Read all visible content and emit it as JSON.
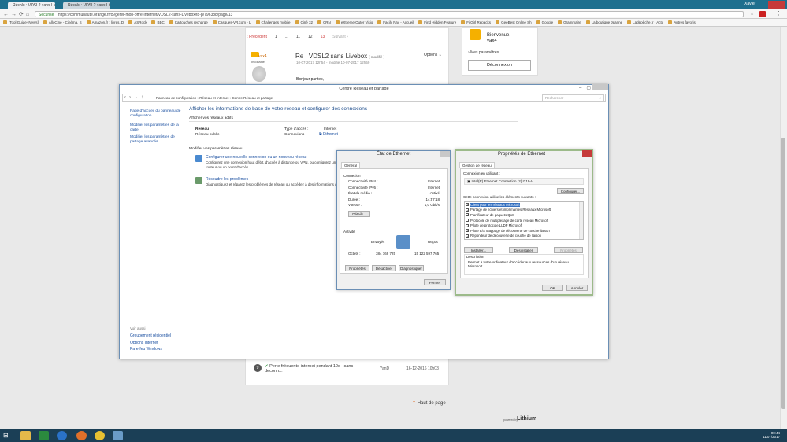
{
  "browser": {
    "tabs": [
      {
        "label": "Résolu : VDSL2 sans Liv"
      },
      {
        "label": "Résolu : VDSL2 sans Liv"
      }
    ],
    "user": "Xavier",
    "secure": "Sécurisé",
    "url": "https://communaute.orange.fr/t5/gérer-mon-offre-Internet/VDSL2-sans-Livebox/td-p/796388/page/13",
    "bookmarks": [
      "[Tool Guide+News]",
      "AlloCiné - Cinéma, S",
      "Amazon.fr : livres, D",
      "ASRock",
      "BBC",
      "Cartouches recharge",
      "Casques-VR.com - L",
      "Challenges mobile",
      "Ciné 32",
      "CRN",
      "eXtreme Outer Visio",
      "Facily Pay - Accueil",
      "Find Hidden Feature",
      "FitGirl Repacks",
      "GeeBest Online Sh",
      "Google",
      "Grammaire",
      "La boutique Jeanne",
      "Ladépêche.fr - Actu",
      "Autres favoris"
    ]
  },
  "forum": {
    "pagination": {
      "prev": "Précédent",
      "pages": [
        "1",
        "...",
        "11",
        "12",
        "13"
      ],
      "next": "Suivant"
    },
    "post": {
      "author": "vax4",
      "rank": "Incollable",
      "title": "Re : VDSL2 sans Livebox",
      "modified": "[ modifié ]",
      "date": "10-07-2017 12h54 - modifié 10-07-2017 12h59",
      "options": "Options",
      "body": "Bonjour pantec,"
    },
    "sidebar": {
      "welcome": "Bienvenue,",
      "user": "vax4",
      "settings": "Mes paramètres",
      "logout": "Déconnexion"
    },
    "related": {
      "title": "Perte fréquente internet pendant 10s - sans deconn...",
      "author": "YanD",
      "date": "16-12-2016 10h03",
      "count": "9"
    },
    "top": "Haut de page",
    "powered": "powered by",
    "brand": "Lithium"
  },
  "cp": {
    "title": "Centre Réseau et partage",
    "breadcrumb": [
      "Panneau de configuration",
      "Réseau et Internet",
      "Centre Réseau et partage"
    ],
    "search": "Rechercher",
    "side": [
      "Page d'accueil du panneau de configuration",
      "Modifier les paramètres de la carte",
      "Modifier les paramètres de partage avancés"
    ],
    "see_also_title": "Voir aussi",
    "see_also": [
      "Groupement résidentiel",
      "Options Internet",
      "Pare-feu Windows"
    ],
    "heading": "Afficher les informations de base de votre réseau et configurer des connexions",
    "active": "Afficher vos réseaux actifs",
    "net_name": "Réseau",
    "net_type": "Réseau public",
    "access_label": "Type d'accès :",
    "access_value": "Internet",
    "conn_label": "Connexions :",
    "conn_value": "Ethernet",
    "modify": "Modifier vos paramètres réseau",
    "task1": "Configurer une nouvelle connexion ou un nouveau réseau",
    "task1_desc": "Configurez une connexion haut débit, d'accès à distance ou VPN, ou configurez un routeur ou un point d'accès.",
    "task2": "Résoudre les problèmes",
    "task2_desc": "Diagnostiquez et réparez les problèmes de réseau ou accédez à des informations de dépannage."
  },
  "eth": {
    "title": "État de Ethernet",
    "tab": "Général",
    "conn": "Connexion",
    "rows": [
      {
        "k": "Connectivité IPv4 :",
        "v": "Internet"
      },
      {
        "k": "Connectivité IPv6 :",
        "v": "Internet"
      },
      {
        "k": "État du média :",
        "v": "Activé"
      },
      {
        "k": "Durée :",
        "v": "14:57:18"
      },
      {
        "k": "Vitesse :",
        "v": "1,0 Gbit/s"
      }
    ],
    "details": "Détails...",
    "activity": "Activité",
    "sent": "Envoyés",
    "recv": "Reçus",
    "bytes_label": "Octets :",
    "bytes_sent": "384 769 725",
    "bytes_recv": "15 122 597 765",
    "btns": [
      "Propriétés",
      "Désactiver",
      "Diagnostiquer"
    ],
    "close": "Fermer"
  },
  "props": {
    "title": "Propriétés de Ethernet",
    "tab": "Gestion de réseau",
    "using": "Connexion en utilisant :",
    "adapter": "Intel(R) Ethernet Connection (2) I219-V",
    "configure": "Configurer...",
    "items_label": "Cette connexion utilise les éléments suivants :",
    "items": [
      {
        "label": "Client pour les réseaux Microsoft",
        "checked": true
      },
      {
        "label": "Partage de fichiers et imprimantes Réseaux Microsoft",
        "checked": true
      },
      {
        "label": "Planificateur de paquets QoS",
        "checked": true
      },
      {
        "label": "Protocole de multiplexage de carte réseau Microsoft",
        "checked": false
      },
      {
        "label": "Pilote de protocole LLDP Microsoft",
        "checked": true
      },
      {
        "label": "Pilote E/S Mappage de découverte de couche liaison",
        "checked": true
      },
      {
        "label": "Répondeur de découverte de couche de liaison",
        "checked": true
      }
    ],
    "install": "Installer...",
    "uninstall": "Désinstaller",
    "properties": "Propriétés",
    "desc_title": "Description",
    "desc": "Permet à votre ordinateur d'accéder aux ressources d'un réseau Microsoft.",
    "ok": "OK",
    "cancel": "Annuler"
  },
  "clock": {
    "time": "00:44",
    "date": "11/07/2017"
  }
}
